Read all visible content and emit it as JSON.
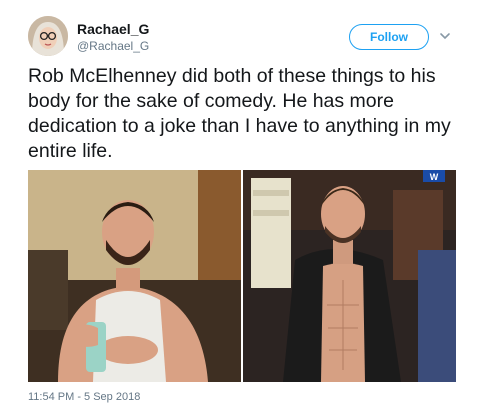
{
  "user": {
    "display_name": "Rachael_G",
    "handle": "@Rachael_G"
  },
  "actions": {
    "follow_label": "Follow"
  },
  "tweet": {
    "text": "Rob McElhenney did both of these things to his body for the sake of comedy. He has more dedication to a joke than I have to anything in my entire life.",
    "timestamp": "11:54 PM - 5 Sep 2018"
  },
  "media": {
    "badge_text": "W"
  },
  "colors": {
    "accent": "#1da1f2",
    "secondary_text": "#657786",
    "primary_text": "#14171a"
  },
  "icons": [
    "chevron-down-icon"
  ]
}
